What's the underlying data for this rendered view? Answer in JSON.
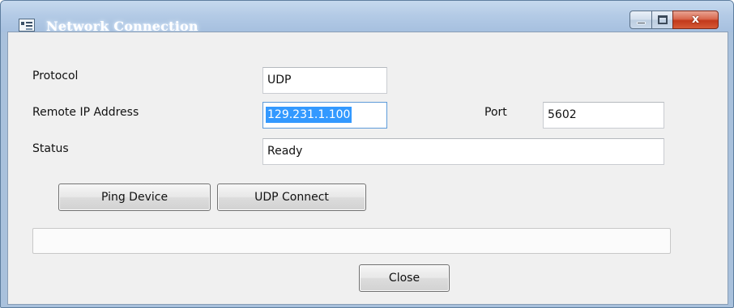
{
  "window": {
    "title": "Network Connection",
    "icon": "window-app-icon",
    "controls": {
      "minimize": "minimize-icon",
      "maximize": "maximize-icon",
      "close": "x",
      "close_icon": "close-icon"
    }
  },
  "form": {
    "protocol_label": "Protocol",
    "protocol_value": "UDP",
    "ip_label": "Remote IP Address",
    "ip_value": "129.231.1.100",
    "port_label": "Port",
    "port_value": "5602",
    "status_label": "Status",
    "status_value": "Ready"
  },
  "buttons": {
    "ping": "Ping Device",
    "connect": "UDP Connect",
    "close": "Close"
  },
  "progress": {
    "value": 0
  },
  "colors": {
    "title_bar": "#b4cbe6",
    "client_bg": "#f0f0f0",
    "selection": "#3399ff",
    "close_button": "#c2391b"
  }
}
